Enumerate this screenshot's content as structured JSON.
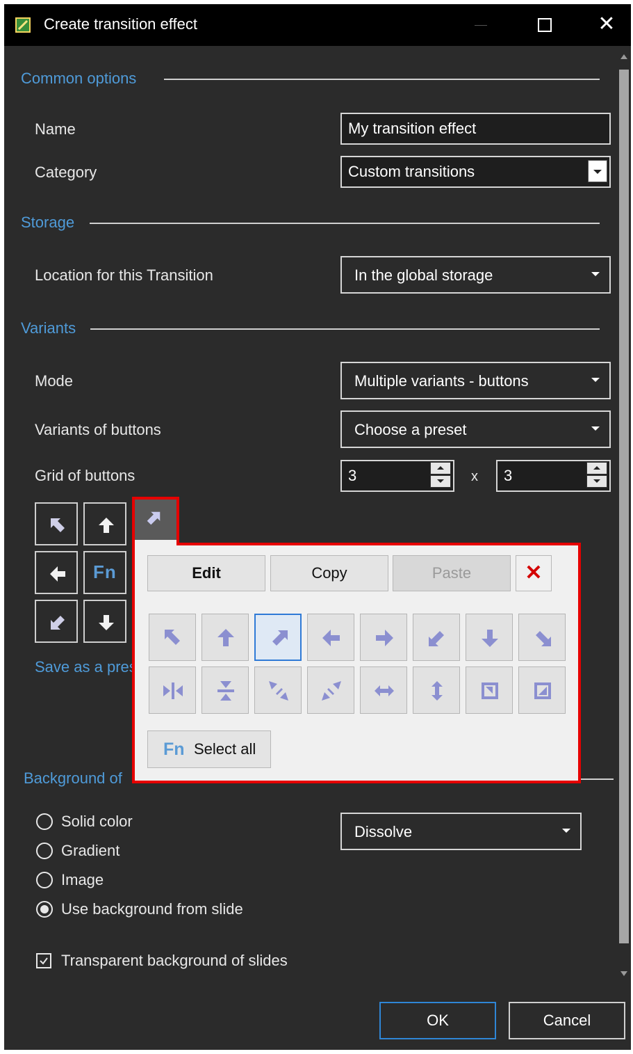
{
  "window": {
    "title": "Create transition effect",
    "close_glyph": "✕"
  },
  "common": {
    "section_title": "Common options",
    "name_label": "Name",
    "name_value": "My transition effect",
    "category_label": "Category",
    "category_value": "Custom transitions"
  },
  "storage": {
    "section_title": "Storage",
    "location_label": "Location for this Transition",
    "location_value": "In the global storage"
  },
  "variants": {
    "section_title": "Variants",
    "mode_label": "Mode",
    "mode_value": "Multiple variants - buttons",
    "buttons_label": "Variants of buttons",
    "buttons_value": "Choose a preset",
    "grid_label": "Grid of buttons",
    "grid_cols": "3",
    "grid_x": "x",
    "grid_rows": "3",
    "fn_label": "Fn",
    "save_link": "Save as a pres"
  },
  "popup": {
    "edit": "Edit",
    "copy": "Copy",
    "paste": "Paste",
    "delete_glyph": "✕",
    "fn_label": "Fn",
    "select_all": "Select all",
    "presets_row1": [
      "arrow-up-left-icon",
      "arrow-up-icon",
      "arrow-up-right-icon",
      "arrow-left-icon",
      "arrow-right-icon",
      "arrow-down-left-icon",
      "arrow-down-icon",
      "arrow-down-right-icon"
    ],
    "presets_row2": [
      "collapse-horizontal-icon",
      "collapse-vertical-icon",
      "collapse-diagonal-icon",
      "collapse-diagonal-alt-icon",
      "expand-horizontal-icon",
      "expand-vertical-icon",
      "shrink-corner-icon",
      "expand-corner-icon"
    ],
    "selected_index": 2
  },
  "background": {
    "section_title": "Background of",
    "options": [
      "Solid color",
      "Gradient",
      "Image",
      "Use background from slide"
    ],
    "selected": 3,
    "effect_value": "Dissolve",
    "transparent_label": "Transparent background of slides",
    "transparent_checked": true
  },
  "footer": {
    "ok": "OK",
    "cancel": "Cancel"
  },
  "colors": {
    "accent": "#4f9bd9",
    "highlight": "#e60000",
    "arrow": "#8b8fd0"
  }
}
